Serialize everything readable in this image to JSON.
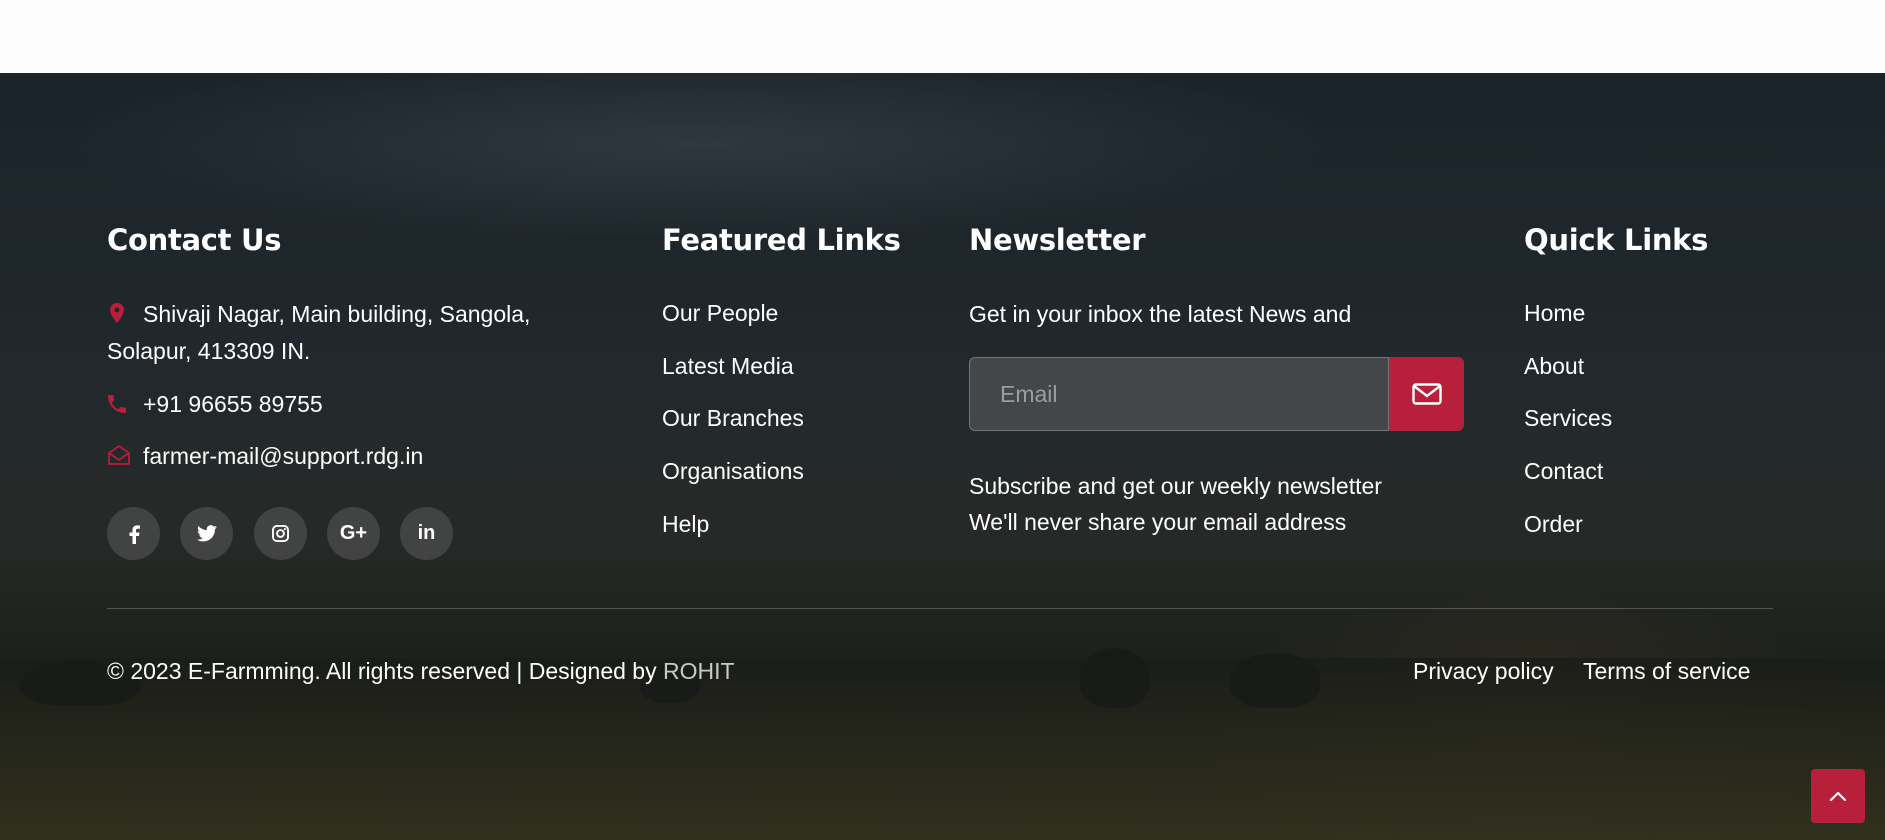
{
  "contact": {
    "title": "Contact Us",
    "address_line1": "Shivaji Nagar, Main building, Sangola,",
    "address_line2": "Solapur, 413309 IN.",
    "phone": "+91 96655 89755",
    "email": "farmer-mail@support.rdg.in",
    "socials": [
      {
        "icon": "facebook-icon",
        "glyph": "f"
      },
      {
        "icon": "twitter-icon",
        "glyph": "t"
      },
      {
        "icon": "instagram-icon",
        "glyph": "ig"
      },
      {
        "icon": "google-plus-icon",
        "glyph": "G+"
      },
      {
        "icon": "linkedin-icon",
        "glyph": "in"
      }
    ]
  },
  "featured": {
    "title": "Featured Links",
    "links": [
      "Our People",
      "Latest Media",
      "Our Branches",
      "Organisations",
      "Help"
    ]
  },
  "newsletter": {
    "title": "Newsletter",
    "intro": "Get in your inbox the latest News and",
    "email_placeholder": "Email",
    "email_value": "",
    "note_line1": "Subscribe and get our weekly newsletter",
    "note_line2": "We'll never share your email address"
  },
  "quick": {
    "title": "Quick Links",
    "links": [
      "Home",
      "About",
      "Services",
      "Contact",
      "Order"
    ]
  },
  "bottom": {
    "copyright": "© 2023 E-Farmming. All rights reserved | Designed by ",
    "designer": "ROHIT",
    "privacy": "Privacy policy",
    "terms": "Terms of service"
  },
  "colors": {
    "accent": "#b71f3b",
    "text": "#ffffff"
  }
}
